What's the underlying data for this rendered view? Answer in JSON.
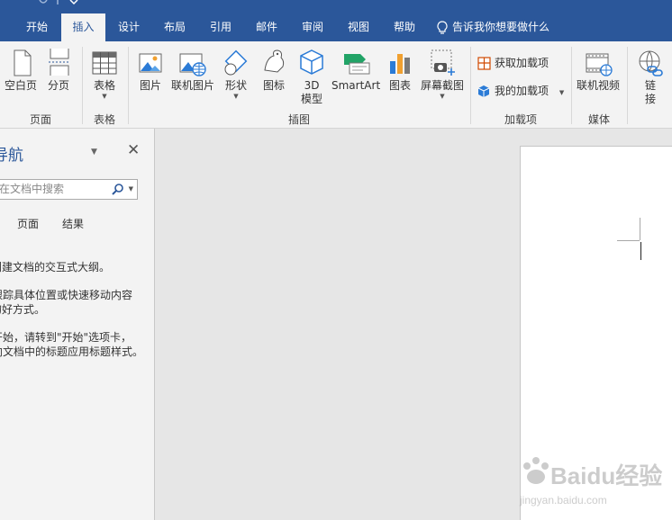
{
  "tabs": [
    "开始",
    "插入",
    "设计",
    "布局",
    "引用",
    "邮件",
    "审阅",
    "视图",
    "帮助"
  ],
  "active_tab": "插入",
  "tell_me": "告诉我你想要做什么",
  "ribbon": {
    "pages": {
      "blank_page": "空白页",
      "page_break": "分页",
      "group": "页面"
    },
    "tables": {
      "table": "表格",
      "group": "表格"
    },
    "illustrations": {
      "picture": "图片",
      "online_picture": "联机图片",
      "shapes": "形状",
      "icons": "图标",
      "model_3d_line1": "3D",
      "model_3d_line2": "模型",
      "smartart": "SmartArt",
      "chart": "图表",
      "screenshot": "屏幕截图",
      "group": "插图"
    },
    "addins": {
      "get_addins": "获取加载项",
      "my_addins": "我的加载项",
      "group": "加载项"
    },
    "media": {
      "online_video": "联机视频",
      "group": "媒体"
    },
    "links": {
      "link_line1": "链",
      "link_line2": "接"
    }
  },
  "nav": {
    "title": "导航",
    "search_placeholder": "在文档中搜索",
    "tabs": [
      "页面",
      "结果"
    ],
    "text1": "创建文档的交互式大纲。",
    "text2a": "它是跟踪具体位置或快速移动内容",
    "text2b": "的好方式。",
    "text3a": "要开始，请转到\"开始\"选项卡，",
    "text3b": "然后向文档中的标题应用标题样式。"
  },
  "watermark": {
    "brand": "Baidu经验",
    "url": "jingyan.baidu.com"
  },
  "colors": {
    "brand": "#2b579a",
    "ribbon_bg": "#f3f3f3",
    "doc_bg": "#e6e6e6"
  }
}
